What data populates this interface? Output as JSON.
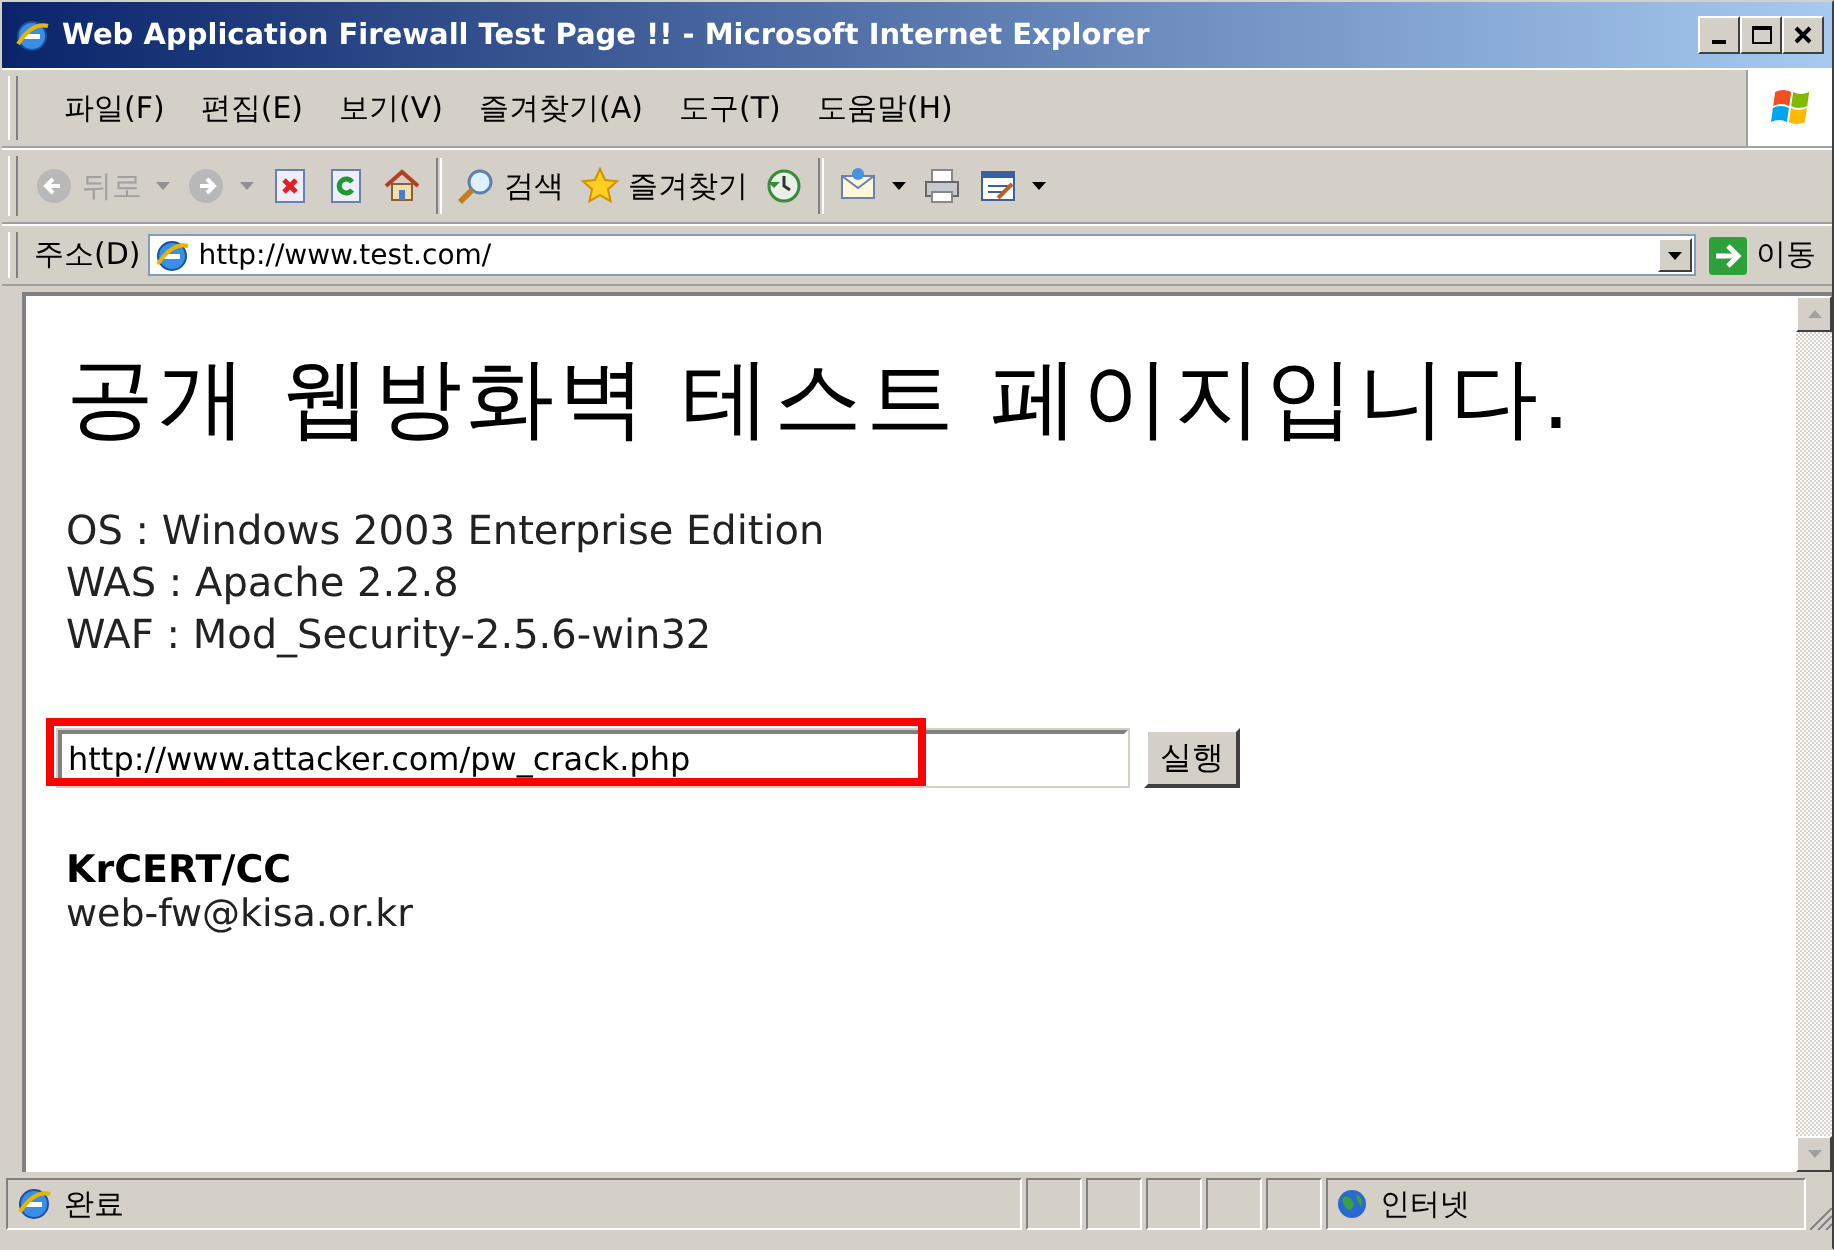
{
  "window": {
    "title": "Web Application Firewall Test Page !! - Microsoft Internet Explorer"
  },
  "menu": [
    {
      "label": "파일(F)"
    },
    {
      "label": "편집(E)"
    },
    {
      "label": "보기(V)"
    },
    {
      "label": "즐겨찾기(A)"
    },
    {
      "label": "도구(T)"
    },
    {
      "label": "도움말(H)"
    }
  ],
  "toolbar": [
    {
      "kind": "back",
      "label": "뒤로",
      "disabled": true,
      "dropdown": true
    },
    {
      "kind": "forward",
      "disabled": true,
      "dropdown": true
    },
    {
      "kind": "stop"
    },
    {
      "kind": "refresh"
    },
    {
      "kind": "home"
    },
    {
      "kind": "separator"
    },
    {
      "kind": "search",
      "label": "검색"
    },
    {
      "kind": "favorites",
      "label": "즐겨찾기"
    },
    {
      "kind": "history"
    },
    {
      "kind": "separator"
    },
    {
      "kind": "mail",
      "dropdown": true
    },
    {
      "kind": "print"
    },
    {
      "kind": "edit",
      "dropdown": true
    }
  ],
  "address_bar": {
    "label": "주소(D)",
    "value": "http://www.test.com/",
    "go_label": "이동"
  },
  "page": {
    "heading": "공개 웹방화벽 테스트 페이지입니다.",
    "info_lines": [
      "OS : Windows 2003 Enterprise Edition",
      "WAS : Apache 2.2.8",
      "WAF : Mod_Security-2.5.6-win32"
    ],
    "url_field": {
      "value": "http://www.attacker.com/pw_crack.php",
      "highlighted": true
    },
    "submit_button": "실행",
    "org": "KrCERT/CC",
    "email": "web-fw@kisa.or.kr"
  },
  "status_bar": {
    "status": "완료",
    "zone": "인터넷"
  }
}
